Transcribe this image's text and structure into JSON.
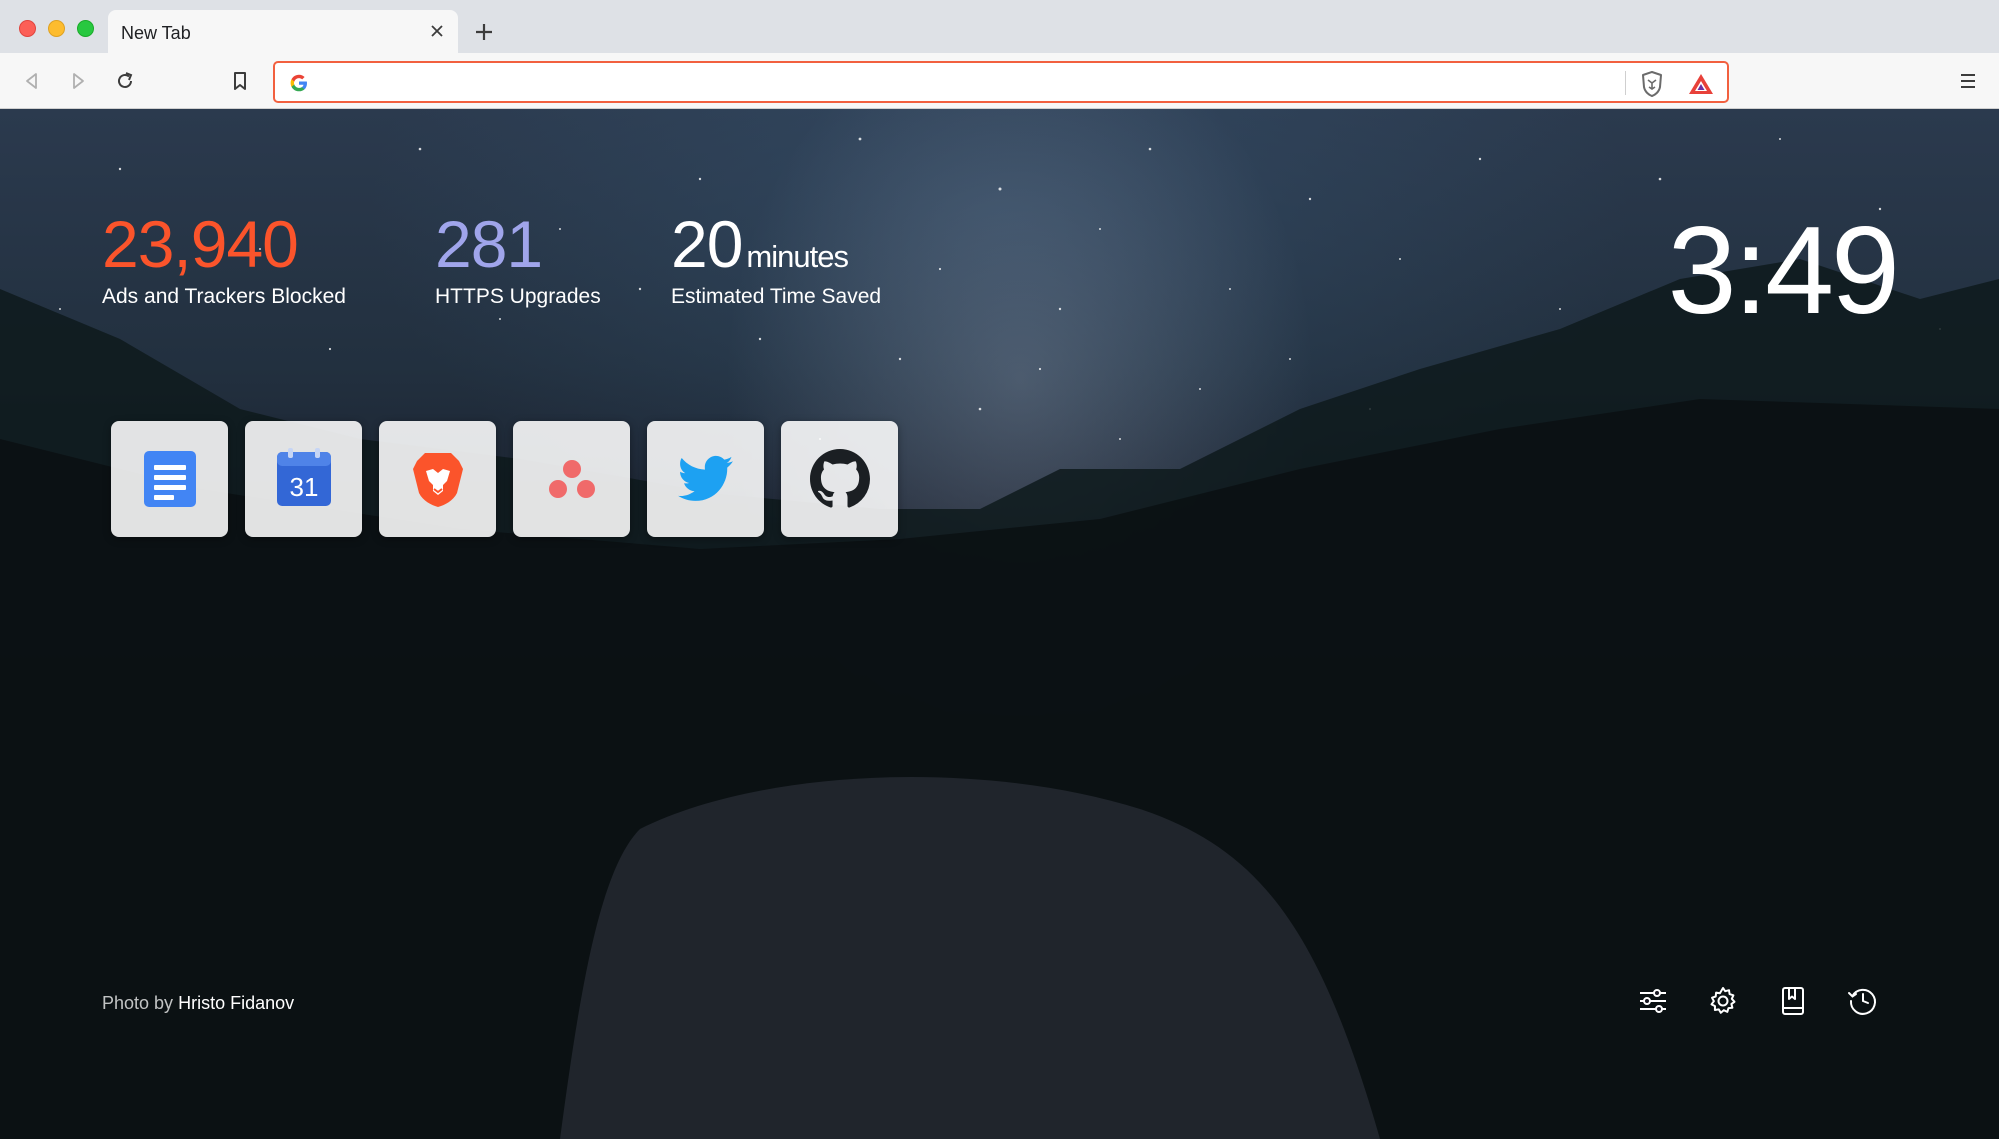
{
  "browser": {
    "tab": {
      "title": "New Tab"
    },
    "urlbar": {
      "value": "",
      "placeholder": ""
    }
  },
  "colors": {
    "brand_orange": "#fb542b",
    "https_blue": "#a0a5eb",
    "urlbar_focus": "#f2603f"
  },
  "stats": {
    "ads": {
      "value": "23,940",
      "label": "Ads and Trackers Blocked"
    },
    "https": {
      "value": "281",
      "label": "HTTPS Upgrades"
    },
    "time": {
      "value": "20",
      "unit": "minutes",
      "label": "Estimated Time Saved"
    }
  },
  "clock": {
    "time": "3:49"
  },
  "top_sites": [
    {
      "name": "Google Docs",
      "icon": "docs-icon"
    },
    {
      "name": "Google Calendar",
      "icon": "calendar-icon",
      "badge": "31"
    },
    {
      "name": "Brave",
      "icon": "brave-lion-icon"
    },
    {
      "name": "Asana",
      "icon": "asana-icon"
    },
    {
      "name": "Twitter",
      "icon": "twitter-bird-icon"
    },
    {
      "name": "GitHub",
      "icon": "github-octocat-icon"
    }
  ],
  "photo_credit": {
    "prefix": "Photo by",
    "author": "Hristo Fidanov"
  },
  "page_actions": [
    "customize-icon",
    "settings-icon",
    "bookmarks-icon",
    "history-icon"
  ]
}
